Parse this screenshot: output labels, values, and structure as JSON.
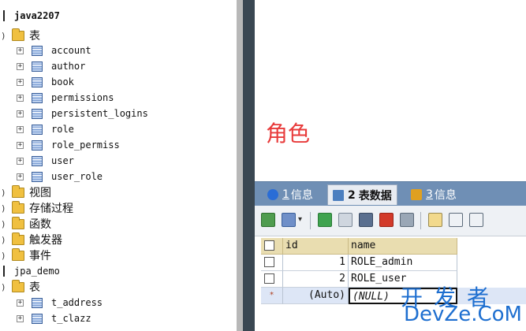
{
  "tree": {
    "db1": {
      "label": "java2207"
    },
    "db1_tables_folder": "表",
    "db1_tables": [
      "account",
      "author",
      "book",
      "permissions",
      "persistent_logins",
      "role",
      "role_permiss",
      "user",
      "user_role"
    ],
    "db1_folders": [
      "视图",
      "存储过程",
      "函数",
      "触发器",
      "事件"
    ],
    "db2": {
      "label": "jpa_demo"
    },
    "db2_tables_folder": "表",
    "db2_tables": [
      "t_address",
      "t_clazz"
    ]
  },
  "overlay": {
    "label": "角色"
  },
  "tabs": [
    {
      "num": "1",
      "label": "信息",
      "icon_color": "#2a6dd6"
    },
    {
      "num": "2",
      "label": "表数据",
      "icon_color": "#4c7fbf"
    },
    {
      "num": "3",
      "label": "信息",
      "icon_color": "#e0a020"
    }
  ],
  "grid": {
    "columns": [
      "id",
      "name"
    ],
    "rows": [
      {
        "id": "1",
        "name": "ROLE_admin"
      },
      {
        "id": "2",
        "name": "ROLE_user"
      },
      {
        "marker": "*",
        "id": "(Auto)",
        "name": "(NULL)"
      }
    ]
  },
  "watermark": {
    "line1": "开发者",
    "line2": "DevZe.CoM"
  },
  "colors": {
    "accent_red": "#e83a3a",
    "tab_bar": "#6f8fb5",
    "header_cell": "#e9ddb0",
    "watermark": "#1e6fd0"
  }
}
